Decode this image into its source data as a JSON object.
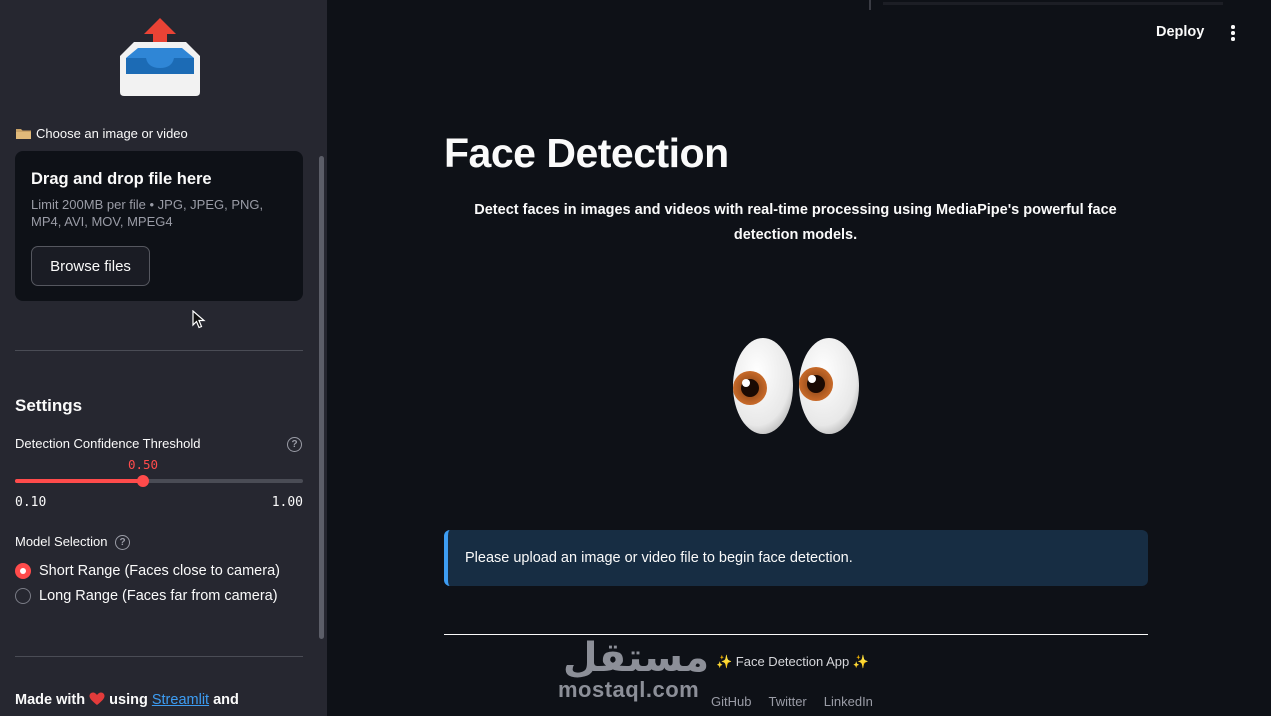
{
  "colors": {
    "accent": "#ff4b4b",
    "link": "#3d9df3",
    "info_bg": "#172d43",
    "sidebar_bg": "#262730",
    "main_bg": "#0e1117"
  },
  "sidebar": {
    "logo_icon": "outbox-tray-icon",
    "upload": {
      "label": "Choose an image or video",
      "label_icon": "folder-icon",
      "drop_title": "Drag and drop file here",
      "limit_text": "Limit 200MB per file • JPG, JPEG, PNG, MP4, AVI, MOV, MPEG4",
      "browse_label": "Browse files"
    },
    "settings": {
      "heading": "Settings",
      "threshold": {
        "label": "Detection Confidence Threshold",
        "value": 0.5,
        "value_text": "0.50",
        "min": 0.1,
        "max": 1.0,
        "min_text": "0.10",
        "max_text": "1.00"
      },
      "model": {
        "label": "Model Selection",
        "options": [
          {
            "label": "Short Range (Faces close to camera)",
            "selected": true
          },
          {
            "label": "Long Range (Faces far from camera)",
            "selected": false
          }
        ]
      }
    },
    "footer": {
      "prefix": "Made with",
      "heart_icon": "red-heart-icon",
      "using": "using",
      "link": "Streamlit",
      "suffix": "and"
    }
  },
  "header": {
    "deploy_label": "Deploy",
    "menu_icon": "kebab-menu-icon"
  },
  "main": {
    "title": "Face Detection",
    "subtitle": "Detect faces in images and videos with real-time processing using MediaPipe's powerful face detection models.",
    "hero_icon": "eyes-emoji-icon",
    "info_message": "Please upload an image or video file to begin face detection.",
    "footer_app": "✨ Face Detection App ✨",
    "footer_links": [
      "GitHub",
      "Twitter",
      "LinkedIn"
    ]
  },
  "watermark": {
    "arabic": "مستقل",
    "latin": "mostaql.com"
  }
}
